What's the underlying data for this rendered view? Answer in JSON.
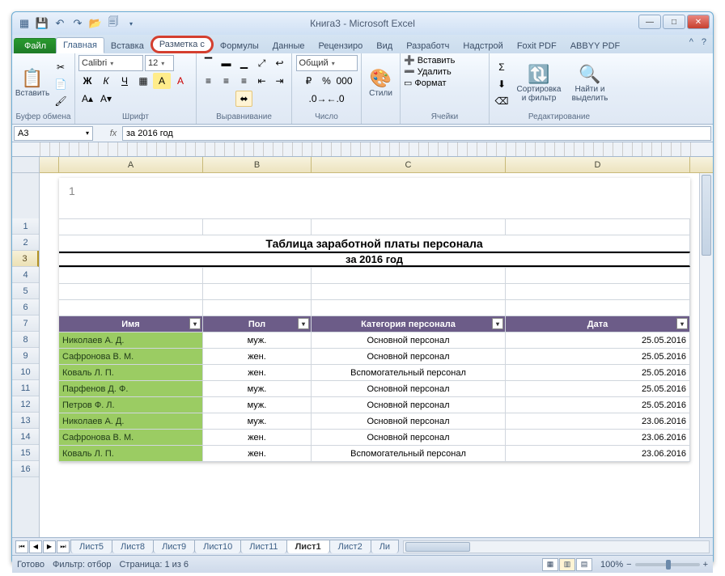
{
  "title": "Книга3 - Microsoft Excel",
  "tabs": {
    "file": "Файл",
    "home": "Главная",
    "insert": "Вставка",
    "pagelayout": "Разметка с",
    "formulas": "Формулы",
    "data": "Данные",
    "review": "Рецензиро",
    "view": "Вид",
    "developer": "Разработч",
    "addins": "Надстрой",
    "foxit": "Foxit PDF",
    "abbyy": "ABBYY PDF"
  },
  "ribbon": {
    "clipboard": {
      "label": "Буфер обмена",
      "paste": "Вставить"
    },
    "font": {
      "label": "Шрифт",
      "face": "Calibri",
      "size": "12"
    },
    "alignment": {
      "label": "Выравнивание"
    },
    "number": {
      "label": "Число",
      "format": "Общий"
    },
    "styles": {
      "label": "",
      "styles_btn": "Стили"
    },
    "cells": {
      "label": "Ячейки",
      "insert": "Вставить",
      "delete": "Удалить",
      "format": "Формат"
    },
    "editing": {
      "label": "Редактирование",
      "sort": "Сортировка\nи фильтр",
      "find": "Найти и\nвыделить"
    }
  },
  "namebox": "A3",
  "formula": "за 2016 год",
  "page_number": "1",
  "colhdrs": [
    "A",
    "B",
    "C",
    "D"
  ],
  "rownums_top": [
    "1",
    "2",
    "3",
    "4",
    "5",
    "6"
  ],
  "rownums_data": [
    "7",
    "8",
    "9",
    "10",
    "11",
    "12",
    "13",
    "14",
    "15",
    "16"
  ],
  "table": {
    "title": "Таблица заработной платы персонала",
    "subtitle": "за 2016 год",
    "headers": [
      "Имя",
      "Пол",
      "Категория персонала",
      "Дата"
    ],
    "rows": [
      [
        "Николаев А. Д.",
        "муж.",
        "Основной персонал",
        "25.05.2016"
      ],
      [
        "Сафронова В. М.",
        "жен.",
        "Основной персонал",
        "25.05.2016"
      ],
      [
        "Коваль Л. П.",
        "жен.",
        "Вспомогательный персонал",
        "25.05.2016"
      ],
      [
        "Парфенов Д. Ф.",
        "муж.",
        "Основной персонал",
        "25.05.2016"
      ],
      [
        "Петров Ф. Л.",
        "муж.",
        "Основной персонал",
        "25.05.2016"
      ],
      [
        "Николаев А. Д.",
        "муж.",
        "Основной персонал",
        "23.06.2016"
      ],
      [
        "Сафронова В. М.",
        "жен.",
        "Основной персонал",
        "23.06.2016"
      ],
      [
        "Коваль Л. П.",
        "жен.",
        "Вспомогательный персонал",
        "23.06.2016"
      ]
    ]
  },
  "sheets": [
    "Лист5",
    "Лист8",
    "Лист9",
    "Лист10",
    "Лист11",
    "Лист1",
    "Лист2",
    "Ли"
  ],
  "active_sheet": "Лист1",
  "status": {
    "ready": "Готово",
    "filter": "Фильтр: отбор",
    "page": "Страница: 1 из 6",
    "zoom": "100%"
  }
}
